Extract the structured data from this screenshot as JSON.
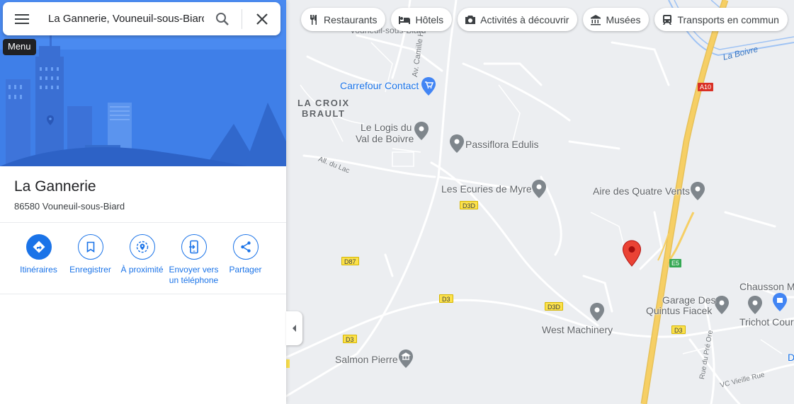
{
  "search": {
    "value": "La Gannerie, Vouneuil-sous-Biard"
  },
  "tooltip": {
    "menu": "Menu"
  },
  "place": {
    "title": "La Gannerie",
    "address": "86580 Vouneuil-sous-Biard"
  },
  "actions": [
    {
      "label": "Itinéraires",
      "icon": "directions-icon"
    },
    {
      "label": "Enregistrer",
      "icon": "bookmark-icon"
    },
    {
      "label": "À proximité",
      "icon": "nearby-icon"
    },
    {
      "label": "Envoyer vers\nun téléphone",
      "icon": "send-to-phone-icon"
    },
    {
      "label": "Partager",
      "icon": "share-icon"
    }
  ],
  "chips": [
    {
      "label": "Restaurants",
      "icon": "restaurant-icon"
    },
    {
      "label": "Hôtels",
      "icon": "hotel-icon"
    },
    {
      "label": "Activités à découvrir",
      "icon": "camera-icon"
    },
    {
      "label": "Musées",
      "icon": "museum-icon"
    },
    {
      "label": "Transports en commun",
      "icon": "transit-icon"
    }
  ],
  "map": {
    "areas": {
      "croix_line1": "LA CROIX",
      "croix_line2": "BRAULT"
    },
    "places": {
      "vouneuil": "Vouneuil-sous-Biard",
      "carrefour": "Carrefour Contact",
      "logis_line1": "Le Logis du",
      "logis_line2": "Val de Boivre",
      "passiflora": "Passiflora Edulis",
      "ecuries": "Les Ecuries de Myre",
      "aire": "Aire des Quatre Vents",
      "chausson": "Chausson Matériaux",
      "garage_line1": "Garage Des",
      "garage_line2": "Quintus Fiacek",
      "trichot": "Trichot Cour",
      "west": "West Machinery",
      "salmon": "Salmon Pierre",
      "d_partial": "D"
    },
    "streets": {
      "camille": "Av. Camille Hablizig",
      "lac": "All. du Lac",
      "pre_ore": "Rue du Pré Ore",
      "vieille": "VC Vieille Rue"
    },
    "water": {
      "boivre": "La Boivre"
    },
    "shields": {
      "a10": "A10",
      "e5": "E5",
      "d3d_a": "D3D",
      "d3d_b": "D3D",
      "d87": "D87",
      "d3_a": "D3",
      "d3_b": "D3",
      "d3_c": "D3"
    }
  },
  "colors": {
    "accent": "#1a73e8",
    "pin_red": "#ea4335",
    "highway": "#f6cf65",
    "hero": "#3f7fe8"
  }
}
